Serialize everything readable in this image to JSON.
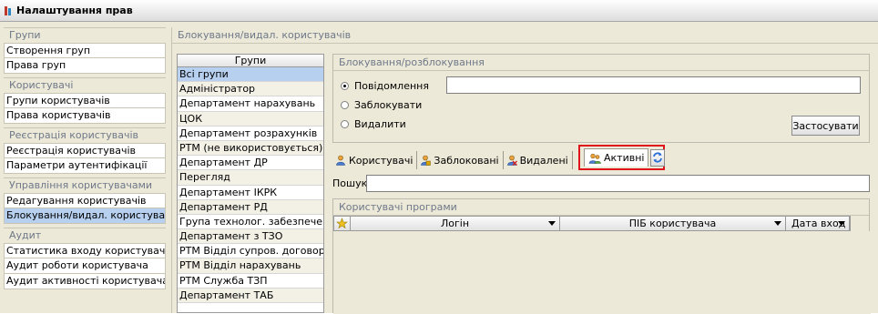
{
  "window": {
    "title": "Налаштування прав"
  },
  "sidebar": {
    "groups": [
      {
        "header": "Групи",
        "items": [
          "Створення груп",
          "Права груп"
        ]
      },
      {
        "header": "Користувачі",
        "items": [
          "Групи користувачів",
          "Права користувачів"
        ]
      },
      {
        "header": "Реєстрація користувачів",
        "items": [
          "Реєстрація користувачів",
          "Параметри аутентифікації"
        ]
      },
      {
        "header": "Управління користувачами",
        "items": [
          "Редагування користувачів",
          "Блокування/видал. користувачів"
        ]
      },
      {
        "header": "Аудит",
        "items": [
          "Статистика входу користувачів",
          "Аудит роботи користувача",
          "Аудит активності користувача"
        ]
      }
    ],
    "selected": "Блокування/видал. користувачів"
  },
  "main": {
    "title": "Блокування/видал. користувачів",
    "groups_list": {
      "header": "Групи",
      "items": [
        "Всі групи",
        "Адміністратор",
        "Департамент нарахувань",
        "ЦОК",
        "Департамент розрахунків",
        "РТМ (не використовується)",
        "Департамент ДР",
        "Перегляд",
        "Департамент ІКРК",
        "Департамент РД",
        "Група технолог. забезпечення",
        "Департамент з ТЗО",
        "РТМ Відділ супров. договорів",
        "РТМ Відділ нарахувань",
        "РТМ Служба ТЗП",
        "Департамент ТАБ"
      ],
      "selected_index": 0
    },
    "block_box": {
      "header": "Блокування/розблокування",
      "options": [
        "Повідомлення",
        "Заблокувати",
        "Видалити"
      ],
      "selected_option": "Повідомлення",
      "message_value": "",
      "apply_label": "Застосувати"
    },
    "tabs": [
      "Користувачі",
      "Заблоковані",
      "Видалені"
    ],
    "active_tab": "Активні",
    "search": {
      "label": "Пошук:",
      "value": ""
    },
    "users_box": {
      "header": "Користувачі програми",
      "columns": [
        "Логін",
        "ПІБ користувача",
        "Дата вход"
      ]
    }
  },
  "colors": {
    "selection": "#b7d0ef",
    "highlight_frame": "#e0141b",
    "panel": "#ece9d8",
    "section_header_text": "#6e7888"
  }
}
